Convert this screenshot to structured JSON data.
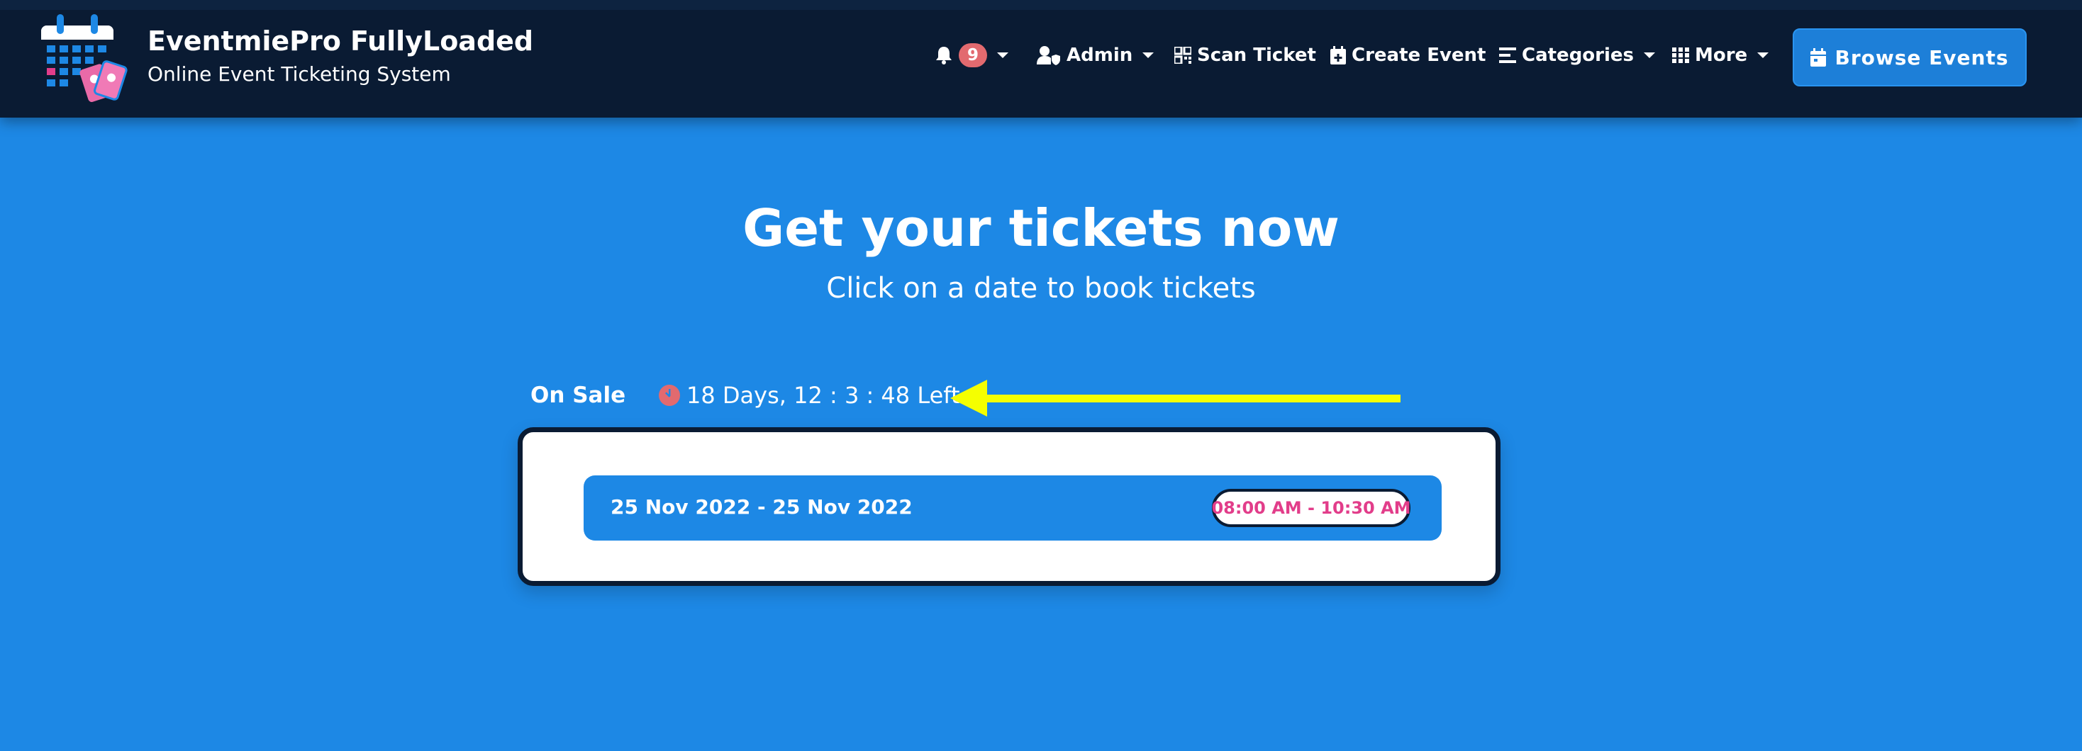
{
  "header": {
    "brand_title": "EventmiePro FullyLoaded",
    "brand_subtitle": "Online Event Ticketing System",
    "logo_icon": "calendar-ticket-logo",
    "notifications": {
      "icon": "bell-icon",
      "count": "9"
    },
    "nav": [
      {
        "label": "Admin",
        "icon": "user-shield-icon",
        "dropdown": true
      },
      {
        "label": "Scan Ticket",
        "icon": "qrcode-icon",
        "dropdown": false
      },
      {
        "label": "Create Event",
        "icon": "calendar-plus-icon",
        "dropdown": false
      },
      {
        "label": "Categories",
        "icon": "bars-icon",
        "dropdown": true
      },
      {
        "label": "More",
        "icon": "grid-icon",
        "dropdown": true
      }
    ],
    "browse_button": {
      "label": "Browse Events",
      "icon": "calendar-icon"
    }
  },
  "hero": {
    "title": "Get your tickets now",
    "subtitle": "Click on a date to book tickets"
  },
  "booking": {
    "status_label": "On Sale",
    "countdown": "18 Days, 12 : 3 : 48 Left",
    "dates": [
      {
        "range": "25 Nov 2022 - 25 Nov 2022",
        "time": "08:00 AM - 10:30 AM"
      }
    ]
  },
  "colors": {
    "page_bg": "#1d88e5",
    "navbar_bg": "#0a1b33",
    "badge": "#e26a6f",
    "time_text": "#e23d8a",
    "arrow": "#f5ff00"
  }
}
